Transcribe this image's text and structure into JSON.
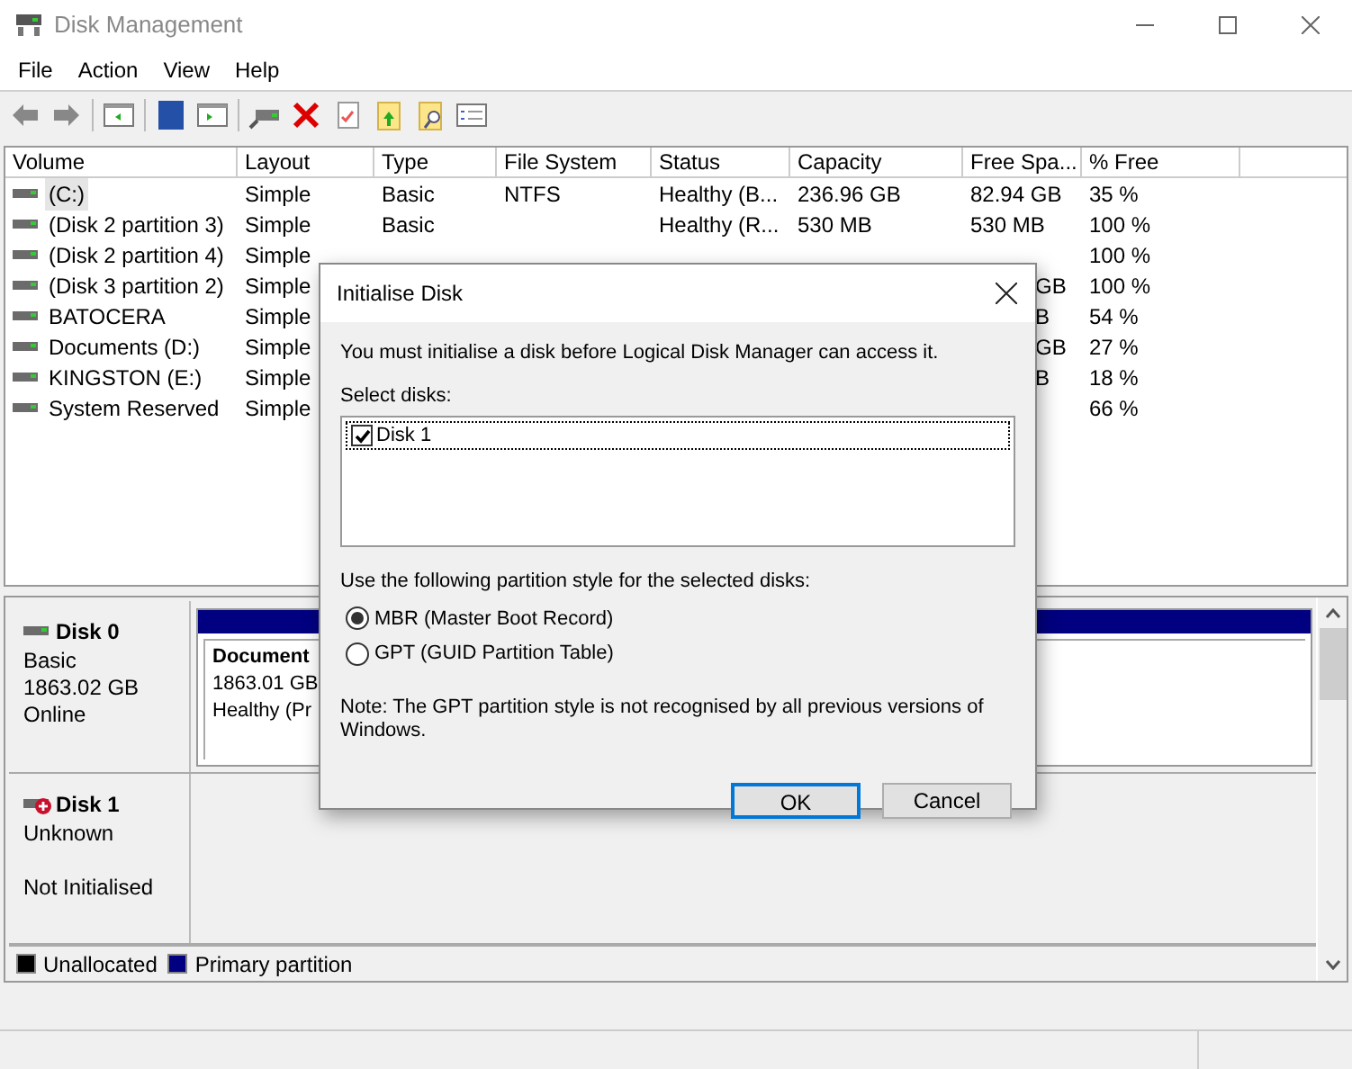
{
  "window": {
    "title": "Disk Management"
  },
  "menu": [
    "File",
    "Action",
    "View",
    "Help"
  ],
  "table": {
    "columns": [
      "Volume",
      "Layout",
      "Type",
      "File System",
      "Status",
      "Capacity",
      "Free Spa...",
      "% Free"
    ],
    "rows": [
      {
        "selected": true,
        "cells": [
          "(C:)",
          "Simple",
          "Basic",
          "NTFS",
          "Healthy (B...",
          "236.96 GB",
          "82.94 GB",
          "35 %"
        ]
      },
      {
        "selected": false,
        "cells": [
          "(Disk 2 partition 3)",
          "Simple",
          "Basic",
          "",
          "Healthy (R...",
          "530 MB",
          "530 MB",
          "100 %"
        ]
      },
      {
        "selected": false,
        "cells": [
          "(Disk 2 partition 4)",
          "Simple",
          "",
          "",
          "",
          "",
          "",
          "100 %"
        ]
      },
      {
        "selected": false,
        "cells": [
          "(Disk 3 partition 2)",
          "Simple",
          "",
          "",
          "",
          "",
          "GB",
          "100 %"
        ]
      },
      {
        "selected": false,
        "cells": [
          "BATOCERA",
          "Simple",
          "",
          "",
          "",
          "",
          "B",
          "54 %"
        ]
      },
      {
        "selected": false,
        "cells": [
          "Documents (D:)",
          "Simple",
          "",
          "",
          "",
          "",
          "GB",
          "27 %"
        ]
      },
      {
        "selected": false,
        "cells": [
          "KINGSTON (E:)",
          "Simple",
          "",
          "",
          "",
          "",
          "B",
          "18 %"
        ]
      },
      {
        "selected": false,
        "cells": [
          "System Reserved",
          "Simple",
          "",
          "",
          "",
          "",
          "",
          "66 %"
        ]
      }
    ]
  },
  "disks": [
    {
      "name": "Disk 0",
      "kind": "online",
      "lines": [
        "Basic",
        "1863.02 GB",
        "Online"
      ],
      "partition": {
        "name": "Document",
        "size": "1863.01 GB",
        "status": "Healthy (Pr"
      }
    },
    {
      "name": "Disk 1",
      "kind": "error",
      "lines": [
        "Unknown",
        "Not Initialised"
      ]
    }
  ],
  "legend": [
    {
      "label": "Unallocated",
      "color": "#000000"
    },
    {
      "label": "Primary partition",
      "color": "#000080"
    }
  ],
  "dialog": {
    "title": "Initialise Disk",
    "message": "You must initialise a disk before Logical Disk Manager can access it.",
    "select_label": "Select disks:",
    "disks": [
      {
        "label": "Disk 1",
        "checked": true
      }
    ],
    "style_label": "Use the following partition style for the selected disks:",
    "options": [
      {
        "label": "MBR (Master Boot Record)",
        "selected": true
      },
      {
        "label": "GPT (GUID Partition Table)",
        "selected": false
      }
    ],
    "note": "Note: The GPT partition style is not recognised by all previous versions of Windows.",
    "buttons": [
      {
        "label": "OK",
        "default": true
      },
      {
        "label": "Cancel",
        "default": false
      }
    ]
  }
}
